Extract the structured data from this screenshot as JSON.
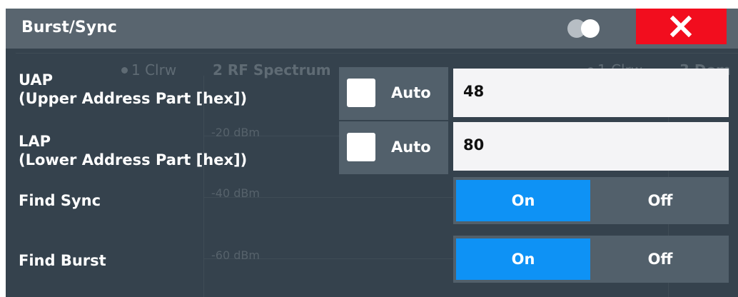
{
  "dialog": {
    "title": "Burst/Sync",
    "close_icon": "close-x-icon",
    "toggle_icon": "overlapping-circles-icon"
  },
  "background": {
    "left_trace": "1 Clrw",
    "left_panel": "2 RF Spectrum",
    "right_trace": "1 Clrw",
    "right_panel": "3 Dem",
    "y_ticks": [
      "-20 dBm",
      "-40 dBm",
      "-60 dBm"
    ]
  },
  "uap": {
    "label_line1": "UAP",
    "label_line2": "(Upper Address Part [hex])",
    "auto_label": "Auto",
    "auto_checked": false,
    "value": "48"
  },
  "lap": {
    "label_line1": "LAP",
    "label_line2": "(Lower Address Part [hex])",
    "auto_label": "Auto",
    "auto_checked": false,
    "value": "80"
  },
  "find_sync": {
    "label": "Find Sync",
    "on_label": "On",
    "off_label": "Off",
    "selected": "On"
  },
  "find_burst": {
    "label": "Find Burst",
    "on_label": "On",
    "off_label": "Off",
    "selected": "On"
  },
  "colors": {
    "dialog_bg": "#35424d",
    "titlebar_bg": "#59656f",
    "close_bg": "#f20d1e",
    "selected_accent": "#0e92f5",
    "control_bg": "#52606b"
  }
}
